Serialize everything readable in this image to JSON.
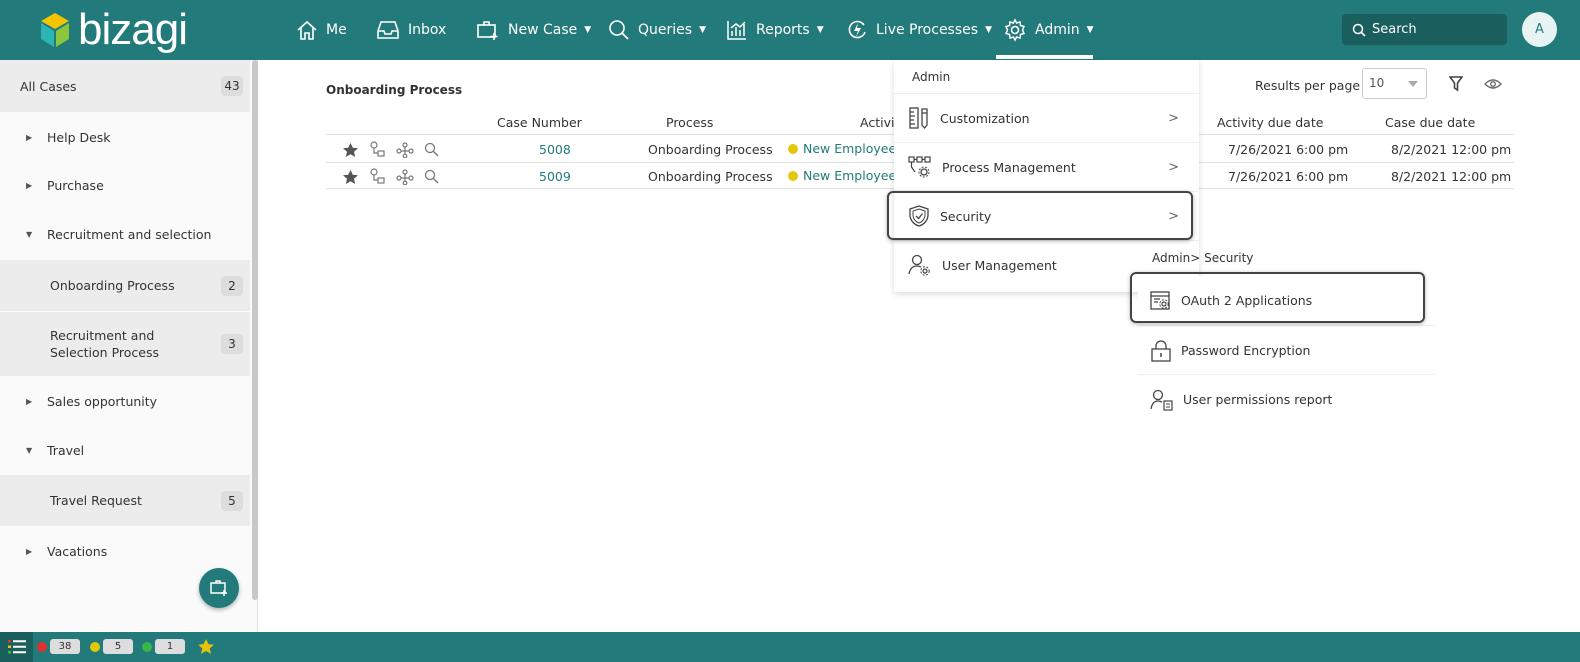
{
  "brand": {
    "name": "bizagi"
  },
  "nav": {
    "me": "Me",
    "inbox": "Inbox",
    "new_case": "New Case",
    "queries": "Queries",
    "reports": "Reports",
    "live_processes": "Live Processes",
    "admin": "Admin"
  },
  "search": {
    "placeholder": "Search"
  },
  "user": {
    "initial": "A"
  },
  "sidebar": {
    "all_cases": {
      "label": "All Cases",
      "count": "43"
    },
    "items": [
      {
        "label": "Help Desk",
        "expanded": false
      },
      {
        "label": "Purchase",
        "expanded": false
      },
      {
        "label": "Recruitment and selection",
        "expanded": true
      },
      {
        "label": "Onboarding Process",
        "count": "2"
      },
      {
        "label": "Recruitment and Selection Process",
        "count": "3"
      },
      {
        "label": "Sales opportunity",
        "expanded": false
      },
      {
        "label": "Travel",
        "expanded": true
      },
      {
        "label": "Travel Request",
        "count": "5"
      },
      {
        "label": "Vacations",
        "expanded": false
      }
    ]
  },
  "main": {
    "title": "Onboarding Process",
    "results_per_page_label": "Results per page",
    "results_per_page_value": "10",
    "columns": [
      "Case Number",
      "Process",
      "Activity",
      "Activity due date",
      "Case due date"
    ],
    "rows": [
      {
        "case_number": "5008",
        "process": "Onboarding Process",
        "activity": "New Employee Ir",
        "activity_due": "7/26/2021 6:00 pm",
        "case_due": "8/2/2021 12:00 pm"
      },
      {
        "case_number": "5009",
        "process": "Onboarding Process",
        "activity": "New Employee Ir",
        "activity_due": "7/26/2021 6:00 pm",
        "case_due": "8/2/2021 12:00 pm"
      }
    ]
  },
  "admin_menu": {
    "header": "Admin",
    "items": [
      "Customization",
      "Process Management",
      "Security",
      "User Management"
    ]
  },
  "security_menu": {
    "header": "Admin> Security",
    "items": [
      "OAuth 2 Applications",
      "Password Encryption",
      "User permissions report"
    ]
  },
  "footer": {
    "red_count": "38",
    "yellow_count": "5",
    "green_count": "1"
  },
  "colors": {
    "brand": "#237a7a",
    "status_red": "#e03030",
    "status_yellow": "#e3c80a",
    "status_green": "#3cb54a",
    "star": "#e8c20a"
  }
}
